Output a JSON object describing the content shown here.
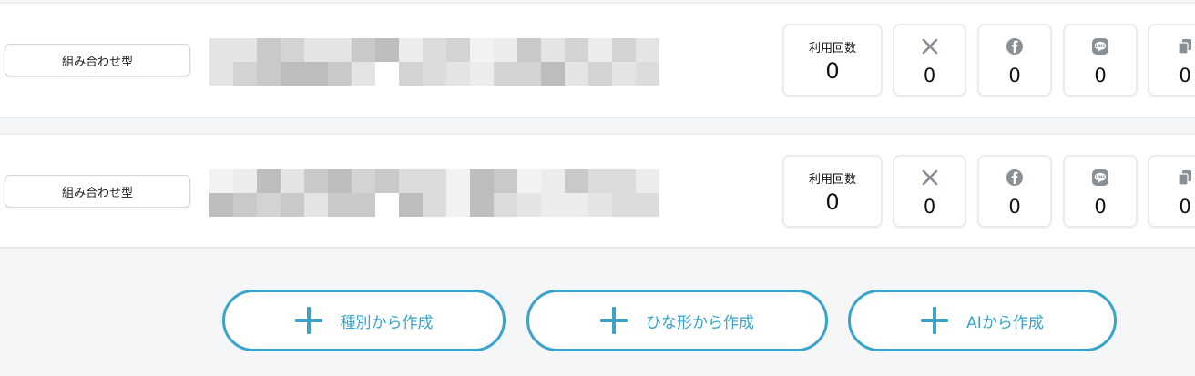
{
  "items": [
    {
      "type_label": "組み合わせ型",
      "stats": {
        "usage_label": "利用回数",
        "usage_value": "0",
        "x_value": "0",
        "facebook_value": "0",
        "line_value": "0",
        "copy_value": "0"
      }
    },
    {
      "type_label": "組み合わせ型",
      "stats": {
        "usage_label": "利用回数",
        "usage_value": "0",
        "x_value": "0",
        "facebook_value": "0",
        "line_value": "0",
        "copy_value": "0"
      }
    }
  ],
  "actions": {
    "create_by_type": "種別から作成",
    "create_from_template": "ひな形から作成",
    "create_with_ai": "AIから作成"
  },
  "icons": {
    "x": "x-icon",
    "facebook": "facebook-icon",
    "line": "line-icon",
    "copy": "copy-icon"
  },
  "colors": {
    "accent": "#3aa3cb",
    "icon_gray": "#8a8f95"
  }
}
